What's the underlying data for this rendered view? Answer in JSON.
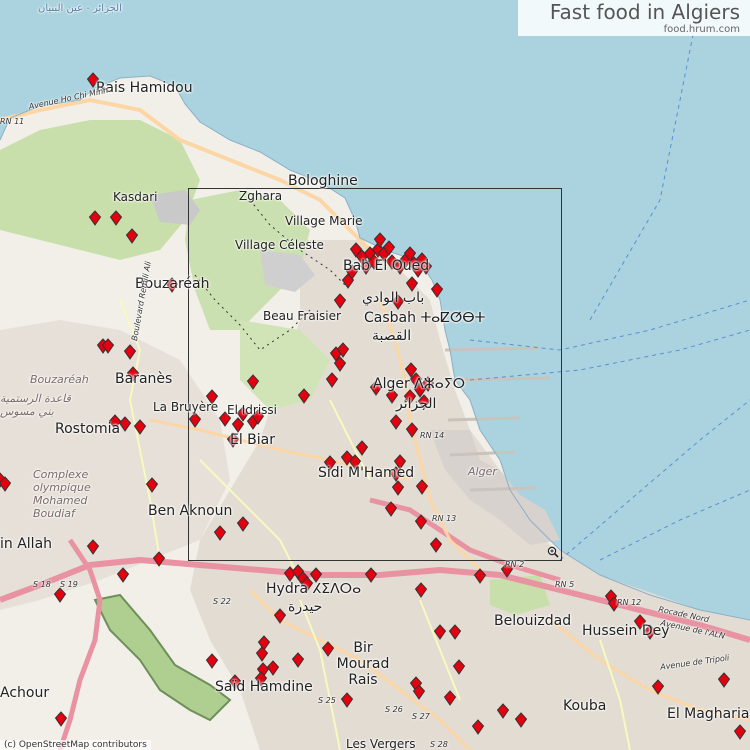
{
  "title": "Fast food in Algiers",
  "subtitle": "food.hrum.com",
  "attribution": "(c) OpenStreetMap contributors",
  "colors": {
    "sea": "#aad3df",
    "land": "#f2efe9",
    "urban": "#e6e0d8",
    "green": "#c8dfab",
    "marker": "#e4000f",
    "motorway": "#e892a2",
    "primary": "#fcd6a4"
  },
  "icons": {
    "marker": "map-pin-icon",
    "zoom": "zoom-in-icon"
  },
  "labels": {
    "rais_hamidou": "Rais Hamidou",
    "bologhine": "Bologhine",
    "zghara": "Zghara",
    "village_marie": "Village Marie",
    "village_celeste": "Village Céleste",
    "kasdari": "Kasdari",
    "bouzareah": "Bouzaréah",
    "bouzareah_it": "Bouzaréah",
    "beau_fraisier": "Beau Fraisier",
    "bab_el_oued": "Bab El Oued",
    "bab_el_oued_ar": "باب الوادي",
    "casbah": "Casbah ⵜⴰⵇⵚⴱⵜ",
    "casbah_ar": "القصبة",
    "baranes": "Baranès",
    "la_bruyere": "La Bruyère",
    "el_idrissi": "El Idrissi",
    "el_biar": "El Biar",
    "rostomia": "Rostomia",
    "rostomia_ar": "قاعدة الرستمية",
    "rostomia_ar2": "بني مسوس",
    "alger": "Alger ⴷⵣⴰⵢⵔ",
    "alger_ar": "الجزائر",
    "alger_port": "Alger",
    "sidi_mhamed": "Sidi M'Hamed",
    "complex": "Complexe olympique Mohamed Boudiaf",
    "ben_aknoun": "Ben Aknoun",
    "ain_allah": "in Allah",
    "hydra": "Hydra ⵃⵉⴷⵔⴰ",
    "hydra_ar": "حيدرة",
    "bir_mourad_rais": "Bir Mourad Rais",
    "saoula_hamdine": "Saïd Hamdine",
    "belouizdad": "Belouizdad",
    "hussein_dey": "Hussein Dey",
    "kouba": "Kouba",
    "el_magharia": "El Magharia",
    "achour": "Achour",
    "les_vergers": "Les Vergers",
    "top_arabic": "الجزائر - عين البنيان",
    "rn11": "RN 11",
    "rn14": "RN 14",
    "rn13": "RN 13",
    "rn2": "RN 2",
    "rn12": "RN 12",
    "rn5": "RN 5",
    "s18": "S 18",
    "s19": "S 19",
    "s22": "S 22",
    "s25": "S 25",
    "s26": "S 26",
    "s27": "S 27",
    "s28": "S 28",
    "av_ho": "Avenue Ho Chi Minh",
    "rocade": "Rocade Nord",
    "av_aln": "Avenue de l'ALN",
    "av_tripoli": "Avenue de Tripoli",
    "remili": "Boulevard Remili Ali"
  }
}
